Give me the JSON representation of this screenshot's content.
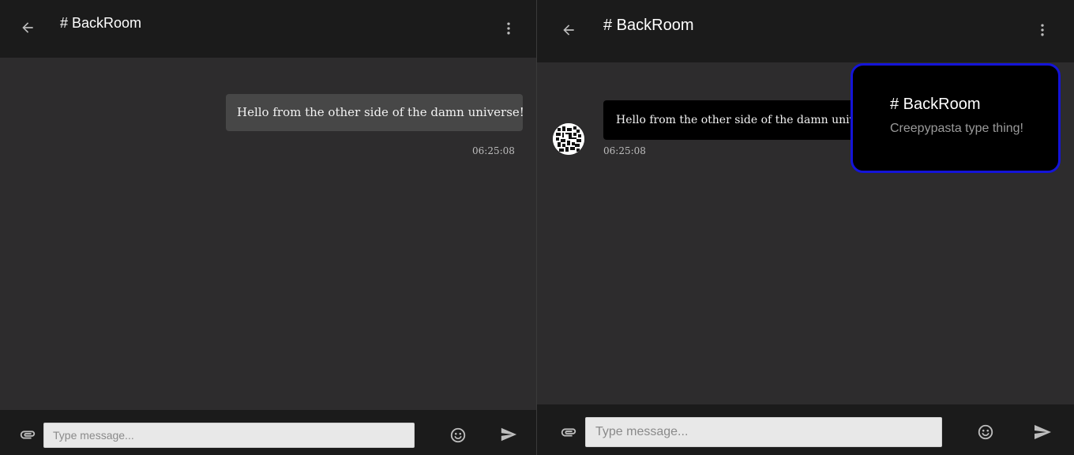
{
  "left_pane": {
    "header": {
      "title": "# BackRoom"
    },
    "message": {
      "text": "Hello from the other side of the damn universe!",
      "time": "06:25:08"
    },
    "footer": {
      "placeholder": "Type message..."
    }
  },
  "right_pane": {
    "header": {
      "title": "# BackRoom"
    },
    "message": {
      "text": "Hello from the other side of the damn universe!",
      "time": "06:25:08"
    },
    "footer": {
      "placeholder": "Type message..."
    },
    "channel_popup": {
      "title": "# BackRoom",
      "description": "Creepypasta type thing!"
    }
  },
  "icons": {
    "back": "arrow-left-icon",
    "menu": "more-vert-icon",
    "attach": "attachment-icon",
    "emoji": "emoji-icon",
    "send": "send-icon"
  },
  "colors": {
    "header_bg": "#1b1b1b",
    "chat_bg": "#2d2c2d",
    "bubble_own": "#474747",
    "bubble_other": "#000000",
    "popup_border": "#1414d8"
  }
}
